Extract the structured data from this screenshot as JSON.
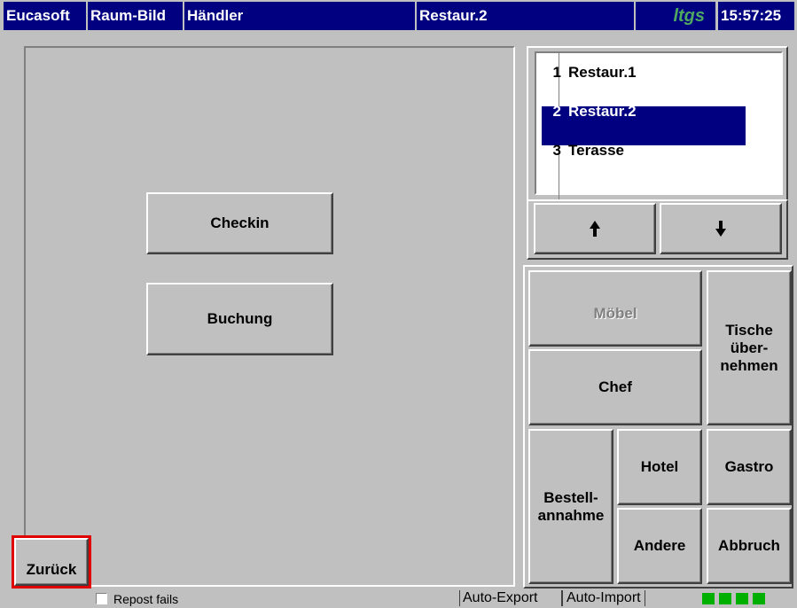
{
  "titlebar": {
    "app": "Eucasoft",
    "view": "Raum-Bild",
    "user": "Händler",
    "room": "Restaur.2",
    "logo": "ltgs",
    "clock": "15:57:25"
  },
  "main": {
    "checkin_label": "Checkin",
    "buchung_label": "Buchung",
    "back_label": "Zurück"
  },
  "room_list": {
    "items": [
      {
        "num": "1",
        "label": "Restaur.1",
        "selected": false
      },
      {
        "num": "2",
        "label": "Restaur.2",
        "selected": true
      },
      {
        "num": "3",
        "label": "Terasse",
        "selected": false
      }
    ],
    "up_icon": "arrow-up-icon",
    "down_icon": "arrow-down-icon"
  },
  "actions": {
    "moebel": "Möbel",
    "chef": "Chef",
    "tische_1": "Tische",
    "tische_2": "über-",
    "tische_3": "nehmen",
    "bestell_1": "Bestell-",
    "bestell_2": "annahme",
    "hotel": "Hotel",
    "gastro": "Gastro",
    "andere": "Andere",
    "abbruch": "Abbruch"
  },
  "statusbar": {
    "repost_label": "Repost fails",
    "auto_export": "Auto-Export",
    "auto_import": "Auto-Import",
    "led_color": "#00b000"
  },
  "colors": {
    "title_bg": "#000080",
    "panel_bg": "#c0c0c0",
    "selection": "#000080",
    "back_border": "#e00000"
  }
}
